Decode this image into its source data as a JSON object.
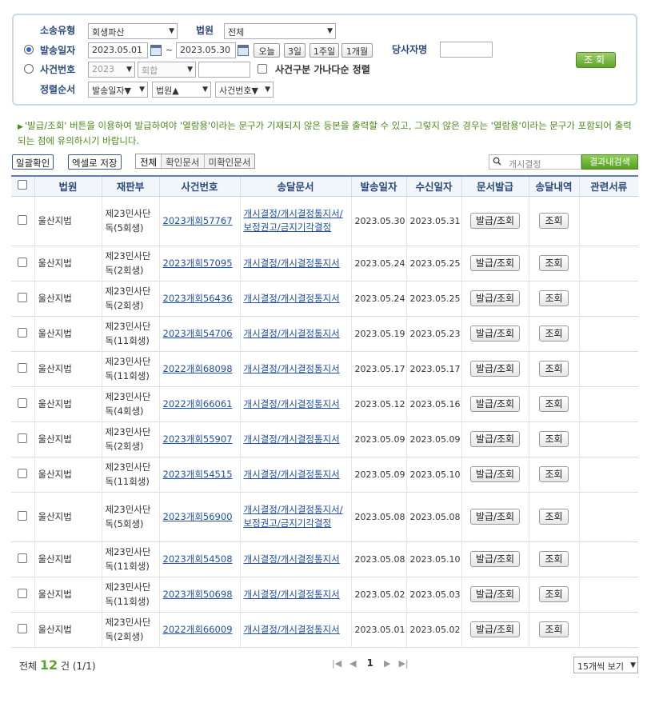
{
  "search": {
    "litigation_type_label": "소송유형",
    "litigation_type_value": "회생파산",
    "court_label": "법원",
    "court_value": "전체",
    "send_date_label": "발송일자",
    "date_from": "2023.05.01",
    "tilde": "~",
    "date_to": "2023.05.30",
    "quick_today": "오늘",
    "quick_3days": "3일",
    "quick_1week": "1주일",
    "quick_1month": "1개월",
    "party_label": "당사자명",
    "case_no_label": "사건번호",
    "case_year": "2023",
    "case_type": "회합",
    "sort_by_case_label": "사건구분 가나다순 정렬",
    "sort_label": "정렬순서",
    "sort1": "발송일자▼",
    "sort2": "법원▲",
    "sort3": "사건번호▼",
    "search_button": "조회"
  },
  "notice": {
    "text": "'발급/조회' 버튼을 이용하여 발급하여야 '열람용'이라는 문구가 기재되지 않은 등본을 출력할 수 있고, 그렇지 않은 경우는 '열람용'이라는 문구가 포함되어 출력되는 점에 유의하시기 바랍니다."
  },
  "toolbar": {
    "bulk_confirm": "일괄확인",
    "save_excel": "엑셀로 저장",
    "filter_all": "전체",
    "filter_confirmed": "확인문서",
    "filter_unconfirmed": "미확인문서",
    "result_search_placeholder": "개시결정",
    "result_search_button": "결과내검색"
  },
  "table": {
    "headers": [
      "법원",
      "재판부",
      "사건번호",
      "송달문서",
      "발송일자",
      "수신일자",
      "문서발급",
      "송달내역",
      "관련서류"
    ],
    "issue_button": "발급/조회",
    "history_button": "조회",
    "rows": [
      {
        "court": "울산지법",
        "division": "제23민사단독(5회생)",
        "case_no": "2023개회57767",
        "doc": "개시결정/개시결정통지서/보정권고/금지기각결정",
        "sent": "2023.05.30",
        "received": "2023.05.31"
      },
      {
        "court": "울산지법",
        "division": "제23민사단독(2회생)",
        "case_no": "2023개회57095",
        "doc": "개시결정/개시결정통지서",
        "sent": "2023.05.24",
        "received": "2023.05.25"
      },
      {
        "court": "울산지법",
        "division": "제23민사단독(2회생)",
        "case_no": "2023개회56436",
        "doc": "개시결정/개시결정통지서",
        "sent": "2023.05.24",
        "received": "2023.05.25"
      },
      {
        "court": "울산지법",
        "division": "제23민사단독(11회생)",
        "case_no": "2023개회54706",
        "doc": "개시결정/개시결정통지서",
        "sent": "2023.05.19",
        "received": "2023.05.23"
      },
      {
        "court": "울산지법",
        "division": "제23민사단독(11회생)",
        "case_no": "2022개회68098",
        "doc": "개시결정/개시결정통지서",
        "sent": "2023.05.17",
        "received": "2023.05.17"
      },
      {
        "court": "울산지법",
        "division": "제23민사단독(4회생)",
        "case_no": "2022개회66061",
        "doc": "개시결정/개시결정통지서",
        "sent": "2023.05.12",
        "received": "2023.05.16"
      },
      {
        "court": "울산지법",
        "division": "제23민사단독(2회생)",
        "case_no": "2023개회55907",
        "doc": "개시결정/개시결정통지서",
        "sent": "2023.05.09",
        "received": "2023.05.09"
      },
      {
        "court": "울산지법",
        "division": "제23민사단독(11회생)",
        "case_no": "2023개회54515",
        "doc": "개시결정/개시결정통지서",
        "sent": "2023.05.09",
        "received": "2023.05.10"
      },
      {
        "court": "울산지법",
        "division": "제23민사단독(5회생)",
        "case_no": "2023개회56900",
        "doc": "개시결정/개시결정통지서/보정권고/금지기각결정",
        "sent": "2023.05.08",
        "received": "2023.05.08"
      },
      {
        "court": "울산지법",
        "division": "제23민사단독(11회생)",
        "case_no": "2023개회54508",
        "doc": "개시결정/개시결정통지서",
        "sent": "2023.05.08",
        "received": "2023.05.10"
      },
      {
        "court": "울산지법",
        "division": "제23민사단독(11회생)",
        "case_no": "2023개회50698",
        "doc": "개시결정/개시결정통지서",
        "sent": "2023.05.02",
        "received": "2023.05.03"
      },
      {
        "court": "울산지법",
        "division": "제23민사단독(2회생)",
        "case_no": "2022개회66009",
        "doc": "개시결정/개시결정통지서",
        "sent": "2023.05.01",
        "received": "2023.05.02"
      }
    ]
  },
  "footer": {
    "total_prefix": "전체",
    "total_count": "12",
    "total_suffix": "건 (1/1)",
    "current_page": "1",
    "per_page": "15개씩 보기"
  }
}
